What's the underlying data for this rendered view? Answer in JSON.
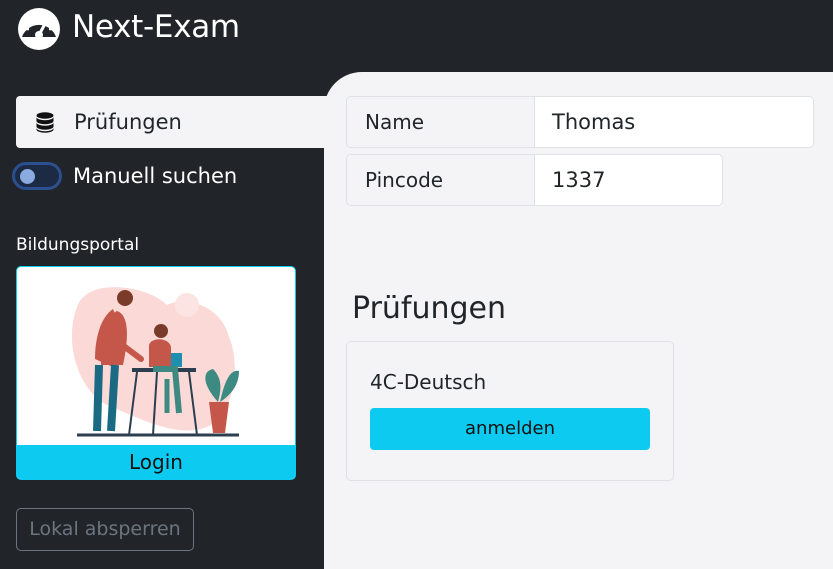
{
  "app": {
    "title": "Next-Exam",
    "logo_icon": "speedometer-icon"
  },
  "sidebar": {
    "nav_item": {
      "label": "Prüfungen",
      "icon": "database-icon"
    },
    "manual_search": {
      "label": "Manuell suchen",
      "checked": false
    },
    "portal": {
      "heading": "Bildungsportal",
      "login_label": "Login"
    },
    "lock_button_label": "Lokal absperren"
  },
  "main": {
    "fields": {
      "name": {
        "label": "Name",
        "value": "Thomas"
      },
      "pincode": {
        "label": "Pincode",
        "value": "1337"
      }
    },
    "exams_title": "Prüfungen",
    "exams": [
      {
        "name": "4C-Deutsch",
        "action_label": "anmelden"
      }
    ]
  },
  "colors": {
    "sidebar_bg": "#212529",
    "content_bg": "#f4f4f6",
    "accent": "#0dcaf0",
    "toggle_border": "#2c4f8f"
  }
}
